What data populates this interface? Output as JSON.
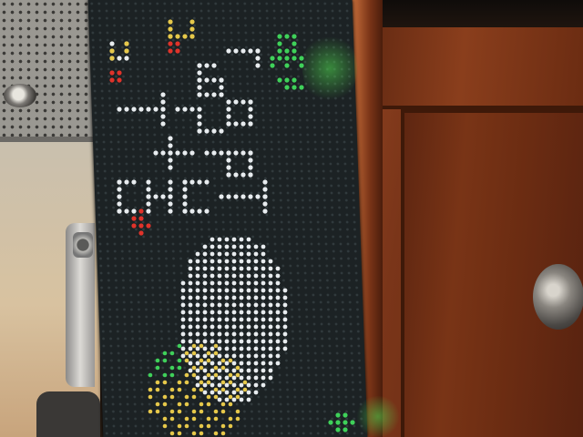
{
  "scene": {
    "subject": "led-matrix-panel",
    "colors": {
      "led_white": "#e8ecef",
      "led_green": "#3fd15a",
      "led_red": "#e0332a",
      "led_yellow": "#e6c84a",
      "led_off": "#313a3d",
      "wood": "#7a3519"
    },
    "icons": [
      "ceiling-light-icon",
      "cabinet-knob-icon",
      "led-sun-icon",
      "led-moon-icon"
    ]
  }
}
